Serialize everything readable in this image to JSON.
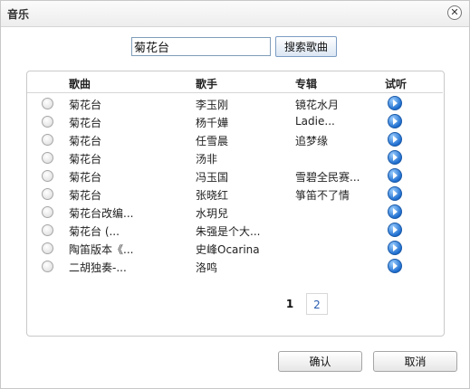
{
  "dialog": {
    "title": "音乐"
  },
  "search": {
    "value": "菊花台",
    "button_label": "搜索歌曲"
  },
  "table": {
    "headers": {
      "song": "歌曲",
      "singer": "歌手",
      "album": "专辑",
      "listen": "试听"
    },
    "rows": [
      {
        "song": "菊花台",
        "singer": "李玉刚",
        "album": "镜花水月"
      },
      {
        "song": "菊花台",
        "singer": "杨千嬅",
        "album": "Ladie..."
      },
      {
        "song": "菊花台",
        "singer": "任雪晨",
        "album": "追梦缘"
      },
      {
        "song": "菊花台",
        "singer": "汤非",
        "album": ""
      },
      {
        "song": "菊花台",
        "singer": "冯玉国",
        "album": "雪碧全民赛..."
      },
      {
        "song": "菊花台",
        "singer": "张晓红",
        "album": "箏笛不了情"
      },
      {
        "song": "菊花台改编...",
        "singer": "水玥兒",
        "album": ""
      },
      {
        "song": "菊花台 (...",
        "singer": "朱强是个大...",
        "album": ""
      },
      {
        "song": "陶笛版本《...",
        "singer": "史峰Ocarina",
        "album": ""
      },
      {
        "song": "二胡独奏-...",
        "singer": "洛鸣",
        "album": ""
      }
    ]
  },
  "pagination": {
    "pages": [
      "1",
      "2"
    ],
    "current": "1"
  },
  "footer": {
    "ok_label": "确认",
    "cancel_label": "取消"
  },
  "icons": {
    "close": "close-icon",
    "play": "play-icon"
  }
}
